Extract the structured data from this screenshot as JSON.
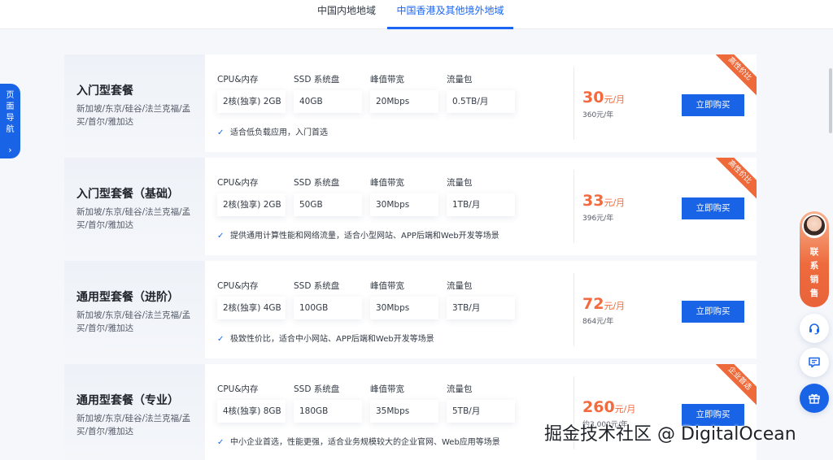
{
  "tabs": [
    {
      "label": "中国内地地域"
    },
    {
      "label": "中国香港及其他境外地域"
    }
  ],
  "spec_headers": {
    "cpu": "CPU&内存",
    "ssd": "SSD 系统盘",
    "bandwidth": "峰值带宽",
    "traffic": "流量包"
  },
  "buy_label": "立即购买",
  "plans": [
    {
      "name": "入门型套餐",
      "regions": "新加坡/东京/硅谷/法兰克福/孟买/首尔/雅加达",
      "cpu": "2核(独享) 2GB",
      "ssd": "40GB",
      "bandwidth": "20Mbps",
      "traffic": "0.5TB/月",
      "feature": "适合低负载应用，入门首选",
      "price_num": "30",
      "price_unit": "元/月",
      "yearly": "360元/年",
      "ribbon": "高性价比"
    },
    {
      "name": "入门型套餐（基础）",
      "regions": "新加坡/东京/硅谷/法兰克福/孟买/首尔/雅加达",
      "cpu": "2核(独享) 2GB",
      "ssd": "50GB",
      "bandwidth": "30Mbps",
      "traffic": "1TB/月",
      "feature": "提供通用计算性能和网络流量，适合小型网站、APP后端和Web开发等场景",
      "price_num": "33",
      "price_unit": "元/月",
      "yearly": "396元/年",
      "ribbon": "高性价比"
    },
    {
      "name": "通用型套餐（进阶）",
      "regions": "新加坡/东京/硅谷/法兰克福/孟买/首尔/雅加达",
      "cpu": "2核(独享) 4GB",
      "ssd": "100GB",
      "bandwidth": "30Mbps",
      "traffic": "3TB/月",
      "feature": "极致性价比，适合中小网站、APP后端和Web开发等场景",
      "price_num": "72",
      "price_unit": "元/月",
      "yearly": "864元/年",
      "ribbon": ""
    },
    {
      "name": "通用型套餐（专业）",
      "regions": "新加坡/东京/硅谷/法兰克福/孟买/首尔/雅加达",
      "cpu": "4核(独享) 8GB",
      "ssd": "180GB",
      "bandwidth": "35Mbps",
      "traffic": "5TB/月",
      "feature": "中小企业首选，性能更强，适合业务规模较大的企业官网、Web应用等场景",
      "price_num": "260",
      "price_unit": "元/月",
      "yearly": "约3,000元/年",
      "ribbon": "企业首选"
    }
  ],
  "page_nav": {
    "text": "页面导航"
  },
  "sales": {
    "text": "联系销售"
  },
  "icons": {
    "check": "check-icon",
    "nav_chevron": "chevron-right-icon",
    "headset": "headset-icon",
    "feedback": "feedback-icon",
    "gift": "gift-icon"
  },
  "colors": {
    "accent": "#1964e6",
    "price": "#f26a3e",
    "ribbon": "#ee6a3a"
  },
  "watermark": "掘金技术社区 @ DigitalOcean"
}
